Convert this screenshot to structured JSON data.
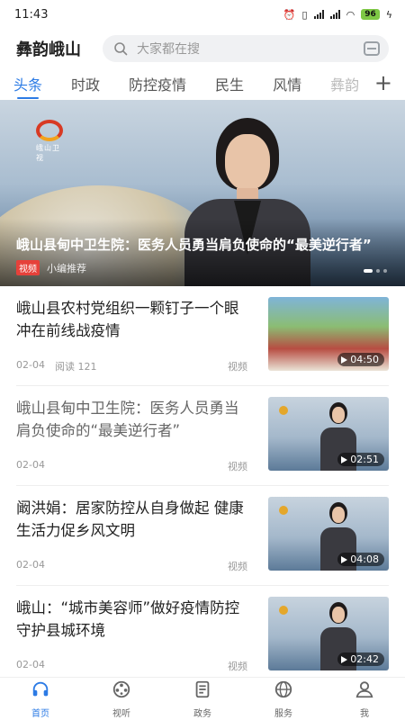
{
  "status_bar": {
    "time": "11:43",
    "battery": "96"
  },
  "header": {
    "app_title": "彝韵峨山",
    "search_placeholder": "大家都在搜"
  },
  "tabs": [
    {
      "label": "头条",
      "active": true
    },
    {
      "label": "时政"
    },
    {
      "label": "防控疫情"
    },
    {
      "label": "民生"
    },
    {
      "label": "风情"
    },
    {
      "label": "彝韵"
    }
  ],
  "hero": {
    "logo_text": "峨山卫视",
    "title": "峨山县甸中卫生院：医务人员勇当肩负使命的“最美逆行者”",
    "tag": "视频",
    "source": "小编推荐"
  },
  "news": [
    {
      "title": "峨山县农村党组织一颗钉子一个眼 冲在前线战疫情",
      "date": "02-04",
      "reads": "阅读 121",
      "type": "视频",
      "duration": "04:50"
    },
    {
      "title": "峨山县甸中卫生院：医务人员勇当肩负使命的“最美逆行者”",
      "date": "02-04",
      "reads": "",
      "type": "视频",
      "duration": "02:51"
    },
    {
      "title": "阚洪娟：居家防控从自身做起 健康生活力促乡风文明",
      "date": "02-04",
      "reads": "",
      "type": "视频",
      "duration": "04:08"
    },
    {
      "title": "峨山：“城市美容师”做好疫情防控 守护县城环境",
      "date": "02-04",
      "reads": "",
      "type": "视频",
      "duration": "02:42"
    }
  ],
  "bottom_nav": [
    {
      "label": "首页",
      "icon": "headphones-icon",
      "active": true
    },
    {
      "label": "视听",
      "icon": "film-reel-icon"
    },
    {
      "label": "政务",
      "icon": "document-icon"
    },
    {
      "label": "服务",
      "icon": "globe-icon"
    },
    {
      "label": "我",
      "icon": "user-icon"
    }
  ],
  "colors": {
    "accent": "#2c7be5",
    "tag_red": "#e6413a"
  }
}
